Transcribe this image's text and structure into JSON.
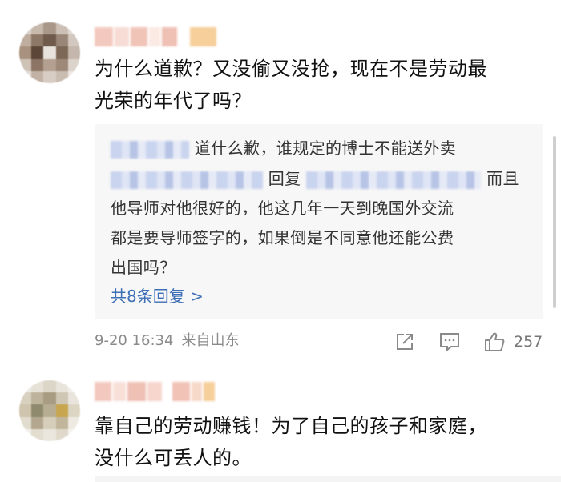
{
  "comments": [
    {
      "text_lines": [
        "为什么道歉？又没偷又没抢，现在不是劳动最",
        "光荣的年代了吗？"
      ],
      "replies": {
        "reply1_text": "道什么歉，谁规定的博士不能送外卖",
        "reply2_prefix": "回复",
        "reply2_suffix": "而且",
        "reply2_lines": [
          "他导师对他很好的，他这几年一天到晚国外交流",
          "都是要导师签字的，如果倒是不同意他还能公费",
          "出国吗？"
        ],
        "more_label": "共8条回复 >"
      },
      "timestamp": "9-20 16:34",
      "source": "来自山东",
      "likes": "257"
    },
    {
      "text_lines": [
        "靠自己的劳动赚钱！为了自己的孩子和家庭，",
        "没什么可丢人的。"
      ]
    }
  ],
  "icons": {
    "share": "share-icon",
    "comment": "comment-icon",
    "like": "thumbs-up-icon"
  },
  "colors": {
    "link": "#3d6fb6",
    "meta": "#8a8a8a",
    "reply_bg": "#f7f7f7"
  }
}
